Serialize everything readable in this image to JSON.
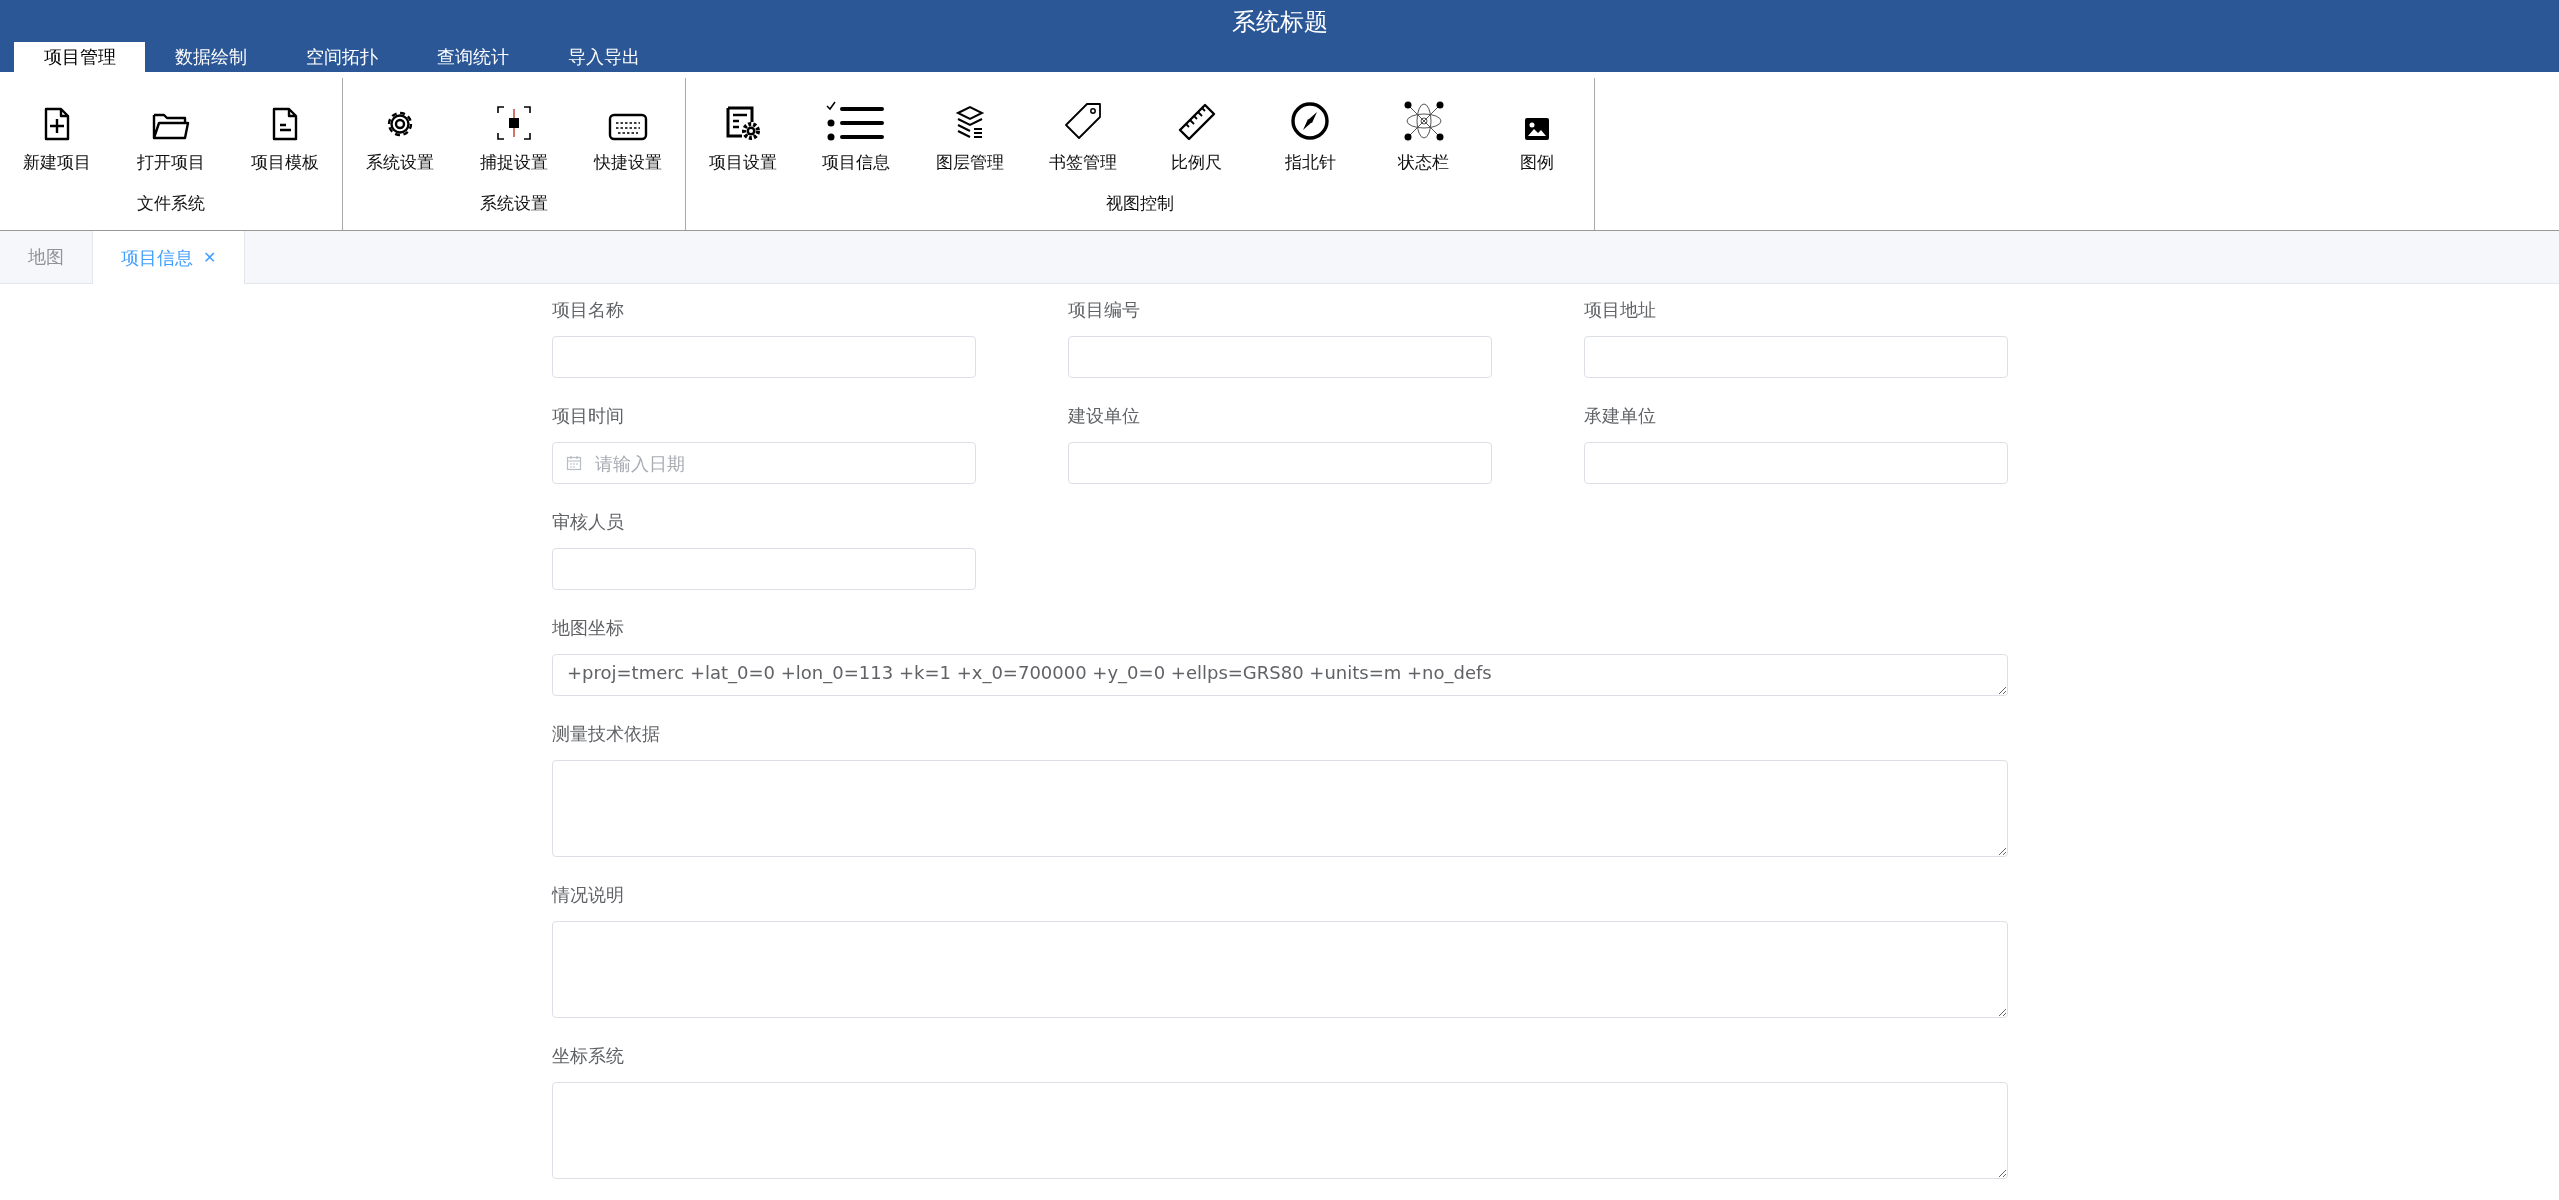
{
  "window": {
    "title": "系统标题"
  },
  "menu_tabs": [
    {
      "label": "项目管理",
      "selected": true
    },
    {
      "label": "数据绘制",
      "selected": false
    },
    {
      "label": "空间拓扑",
      "selected": false
    },
    {
      "label": "查询统计",
      "selected": false
    },
    {
      "label": "导入导出",
      "selected": false
    }
  ],
  "ribbon_groups": [
    {
      "label": "文件系统",
      "buttons": [
        {
          "label": "新建项目",
          "kind": "newfile"
        },
        {
          "label": "打开项目",
          "kind": "folder"
        },
        {
          "label": "项目模板",
          "kind": "document"
        }
      ]
    },
    {
      "label": "系统设置",
      "buttons": [
        {
          "label": "系统设置",
          "kind": "gear"
        },
        {
          "label": "捕捉设置",
          "kind": "snap"
        },
        {
          "label": "快捷设置",
          "kind": "keyboard"
        }
      ]
    },
    {
      "label": "视图控制",
      "buttons": [
        {
          "label": "项目设置",
          "kind": "formgear"
        },
        {
          "label": "项目信息",
          "kind": "list"
        },
        {
          "label": "图层管理",
          "kind": "layers"
        },
        {
          "label": "书签管理",
          "kind": "tag"
        },
        {
          "label": "比例尺",
          "kind": "ruler"
        },
        {
          "label": "指北针",
          "kind": "compass"
        },
        {
          "label": "状态栏",
          "kind": "atom"
        },
        {
          "label": "图例",
          "kind": "image"
        }
      ]
    }
  ],
  "doc_tabs": [
    {
      "label": "地图",
      "selected": false,
      "closable": false
    },
    {
      "label": "项目信息",
      "selected": true,
      "closable": true,
      "close": "✕"
    }
  ],
  "form": {
    "fields": [
      {
        "label": "项目名称",
        "kind": "text"
      },
      {
        "label": "项目编号",
        "kind": "text"
      },
      {
        "label": "项目地址",
        "kind": "text"
      },
      {
        "label": "项目时间",
        "kind": "date",
        "placeholder": "请输入日期"
      },
      {
        "label": "建设单位",
        "kind": "text"
      },
      {
        "label": "承建单位",
        "kind": "text"
      },
      {
        "label": "审核人员",
        "kind": "text"
      },
      {
        "label": "地图坐标",
        "kind": "codearea",
        "value": "+proj=tmerc +lat_0=0 +lon_0=113 +k=1 +x_0=700000 +y_0=0 +ellps=GRS80 +units=m +no_defs"
      },
      {
        "label": "测量技术依据",
        "kind": "textarea"
      },
      {
        "label": "情况说明",
        "kind": "textarea"
      },
      {
        "label": "坐标系统",
        "kind": "textarea"
      }
    ]
  }
}
